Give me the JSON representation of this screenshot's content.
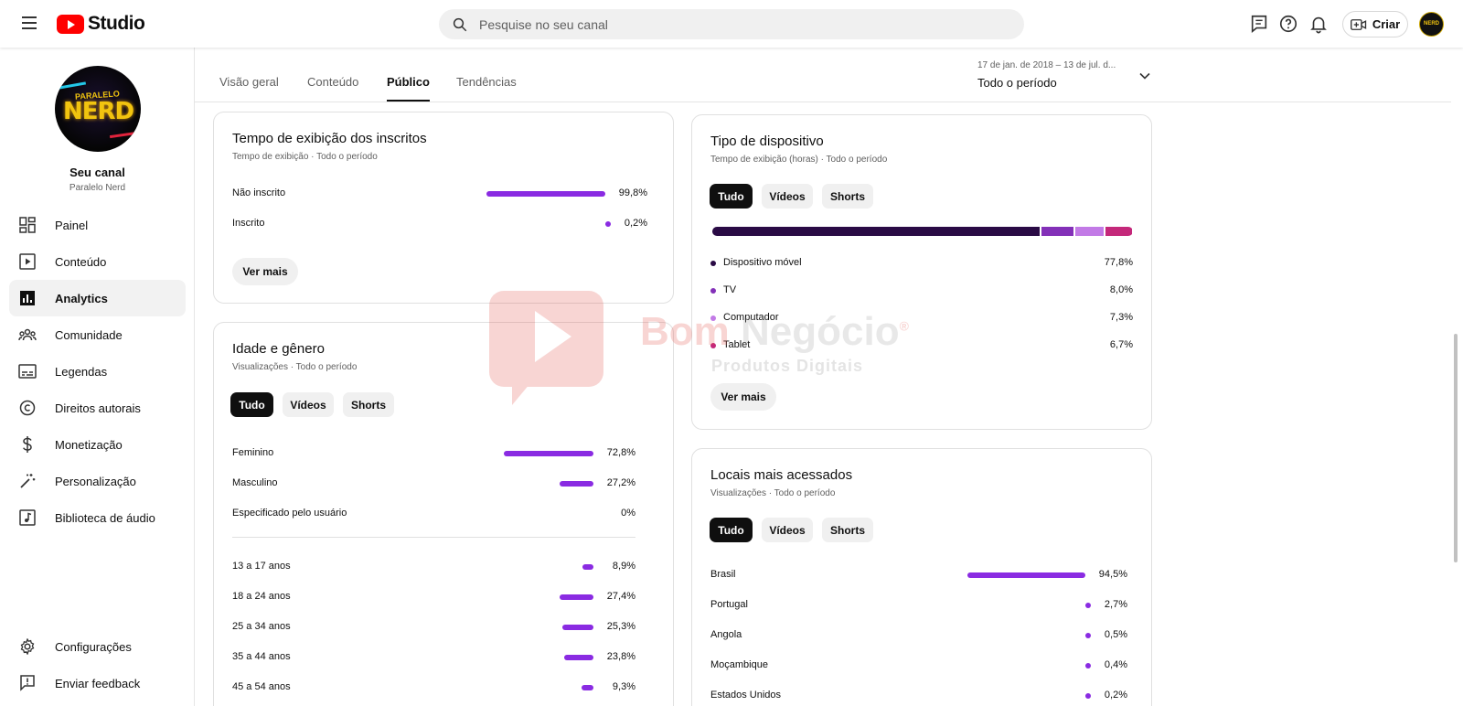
{
  "app": {
    "name": "Studio"
  },
  "search": {
    "placeholder": "Pesquise no seu canal"
  },
  "topbar": {
    "create_label": "Criar"
  },
  "channel": {
    "title": "Seu canal",
    "name": "Paralelo Nerd",
    "avatar_small": "PARALELO",
    "avatar_big": "NERD",
    "avatar_mini": "NERD"
  },
  "sidebar": {
    "items": [
      {
        "label": "Painel",
        "icon": "dashboard-icon"
      },
      {
        "label": "Conteúdo",
        "icon": "content-icon"
      },
      {
        "label": "Analytics",
        "icon": "analytics-icon",
        "active": true
      },
      {
        "label": "Comunidade",
        "icon": "community-icon"
      },
      {
        "label": "Legendas",
        "icon": "subtitles-icon"
      },
      {
        "label": "Direitos autorais",
        "icon": "copyright-icon"
      },
      {
        "label": "Monetização",
        "icon": "monetization-icon"
      },
      {
        "label": "Personalização",
        "icon": "customization-icon"
      },
      {
        "label": "Biblioteca de áudio",
        "icon": "audio-library-icon"
      }
    ],
    "bottom": [
      {
        "label": "Configurações",
        "icon": "settings-icon"
      },
      {
        "label": "Enviar feedback",
        "icon": "feedback-icon"
      }
    ]
  },
  "tabs": [
    "Visão geral",
    "Conteúdo",
    "Público",
    "Tendências"
  ],
  "active_tab": "Público",
  "period": {
    "range": "17 de jan. de 2018 – 13 de jul. d...",
    "label": "Todo o período"
  },
  "subscribers_card": {
    "title": "Tempo de exibição dos inscritos",
    "subtitle": "Tempo de exibição · Todo o período",
    "rows": [
      {
        "label": "Não inscrito",
        "value": "99,8%",
        "share": 99.8
      },
      {
        "label": "Inscrito",
        "value": "0,2%",
        "share": 0.2
      }
    ],
    "more": "Ver mais"
  },
  "age_gender_card": {
    "title": "Idade e gênero",
    "subtitle": "Visualizações · Todo o período",
    "chips": [
      "Tudo",
      "Vídeos",
      "Shorts"
    ],
    "gender": [
      {
        "label": "Feminino",
        "value": "72,8%",
        "share": 72.8
      },
      {
        "label": "Masculino",
        "value": "27,2%",
        "share": 27.2
      },
      {
        "label": "Especificado pelo usuário",
        "value": "0%",
        "share": 0
      }
    ],
    "ages": [
      {
        "label": "13 a 17 anos",
        "value": "8,9%",
        "share": 8.9
      },
      {
        "label": "18 a 24 anos",
        "value": "27,4%",
        "share": 27.4
      },
      {
        "label": "25 a 34 anos",
        "value": "25,3%",
        "share": 25.3
      },
      {
        "label": "35 a 44 anos",
        "value": "23,8%",
        "share": 23.8
      },
      {
        "label": "45 a 54 anos",
        "value": "9,3%",
        "share": 9.3
      }
    ]
  },
  "device_card": {
    "title": "Tipo de dispositivo",
    "subtitle": "Tempo de exibição (horas) · Todo o período",
    "chips": [
      "Tudo",
      "Vídeos",
      "Shorts"
    ],
    "rows": [
      {
        "label": "Dispositivo móvel",
        "value": "77,8%",
        "share": 77.8,
        "color": "#2a0b45"
      },
      {
        "label": "TV",
        "value": "8,0%",
        "share": 8.0,
        "color": "#8330b8"
      },
      {
        "label": "Computador",
        "value": "7,3%",
        "share": 7.3,
        "color": "#c27ae6"
      },
      {
        "label": "Tablet",
        "value": "6,7%",
        "share": 6.7,
        "color": "#c4287a"
      }
    ],
    "more": "Ver mais"
  },
  "locations_card": {
    "title": "Locais mais acessados",
    "subtitle": "Visualizações · Todo o período",
    "chips": [
      "Tudo",
      "Vídeos",
      "Shorts"
    ],
    "rows": [
      {
        "label": "Brasil",
        "value": "94,5%",
        "share": 94.5
      },
      {
        "label": "Portugal",
        "value": "2,7%",
        "share": 2.7
      },
      {
        "label": "Angola",
        "value": "0,5%",
        "share": 0.5
      },
      {
        "label": "Moçambique",
        "value": "0,4%",
        "share": 0.4
      },
      {
        "label": "Estados Unidos",
        "value": "0,2%",
        "share": 0.2
      }
    ]
  },
  "watermark": {
    "brand_a": "Bom",
    "brand_b": "Negócio",
    "reg": "®",
    "tagline": "Produtos Digitais"
  },
  "colors": {
    "accent": "#8a2be2",
    "youtube_red": "#ff0000"
  }
}
